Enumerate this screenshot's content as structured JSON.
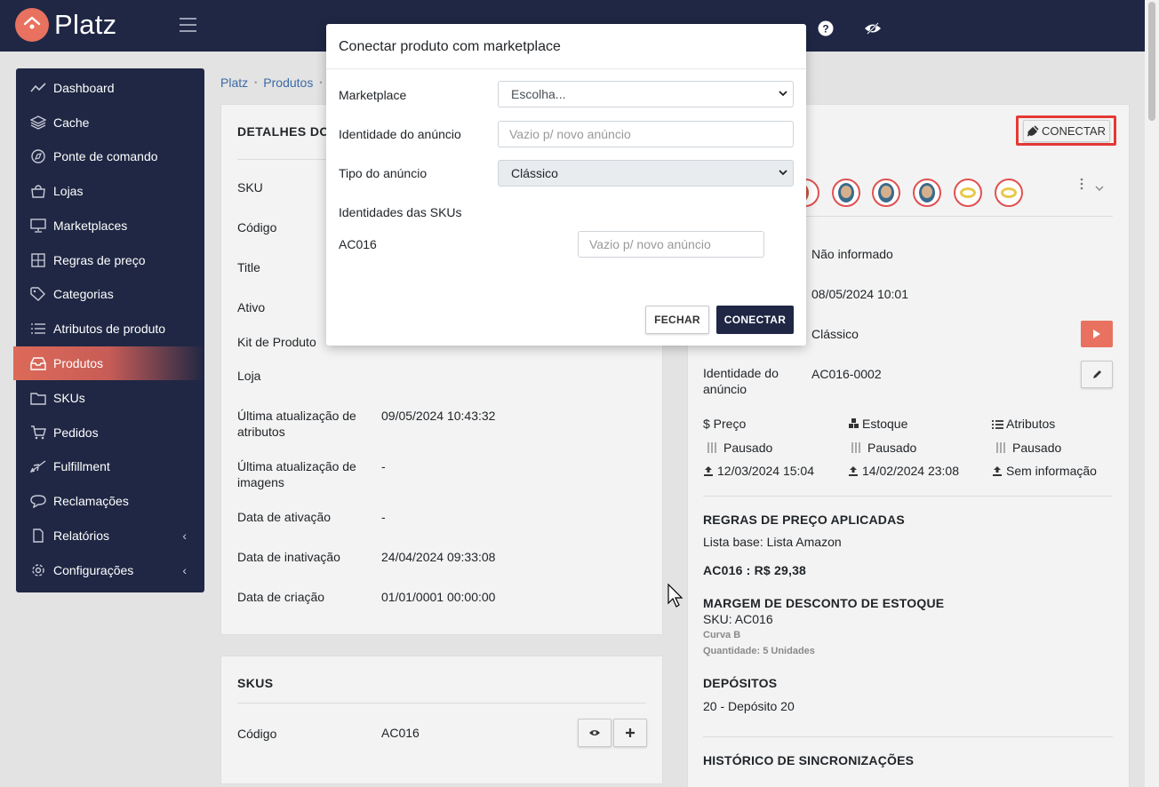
{
  "app": {
    "name": "Platz"
  },
  "colors": {
    "navy": "#1f2744",
    "accent": "#dd6a58",
    "highlight": "#e53935"
  },
  "sidebar": {
    "items": [
      {
        "label": "Dashboard",
        "icon": "chart-line-icon"
      },
      {
        "label": "Cache",
        "icon": "layers-icon"
      },
      {
        "label": "Ponte de comando",
        "icon": "compass-icon"
      },
      {
        "label": "Lojas",
        "icon": "shopping-bag-icon"
      },
      {
        "label": "Marketplaces",
        "icon": "monitor-icon"
      },
      {
        "label": "Regras de preço",
        "icon": "calculator-icon"
      },
      {
        "label": "Categorias",
        "icon": "tag-icon"
      },
      {
        "label": "Atributos de produto",
        "icon": "list-icon"
      },
      {
        "label": "Produtos",
        "icon": "inbox-icon",
        "active": true
      },
      {
        "label": "SKUs",
        "icon": "folder-icon"
      },
      {
        "label": "Pedidos",
        "icon": "cart-icon"
      },
      {
        "label": "Fulfillment",
        "icon": "plane-icon"
      },
      {
        "label": "Reclamações",
        "icon": "chat-bubble-icon"
      },
      {
        "label": "Relatórios",
        "icon": "file-icon",
        "expandable": true
      },
      {
        "label": "Configurações",
        "icon": "gear-icon",
        "expandable": true
      }
    ],
    "chevron": "‹"
  },
  "breadcrumb": {
    "items": [
      "Platz",
      "Produtos"
    ],
    "separator": "•"
  },
  "details": {
    "title": "DETALHES DO",
    "rows": [
      {
        "label": "SKU",
        "value": ""
      },
      {
        "label": "Código",
        "value": ""
      },
      {
        "label": "Title",
        "value": ""
      },
      {
        "label": "Ativo",
        "value": ""
      },
      {
        "label": "Kit de Produto",
        "value": ""
      },
      {
        "label": "Loja",
        "value": ""
      },
      {
        "label": "Última atualização de atributos",
        "value": "09/05/2024 10:43:32"
      },
      {
        "label": "Última atualização de imagens",
        "value": "-"
      },
      {
        "label": "Data de ativação",
        "value": "-"
      },
      {
        "label": "Data de inativação",
        "value": "24/04/2024 09:33:08"
      },
      {
        "label": "Data de criação",
        "value": "01/01/0001 00:00:00"
      }
    ]
  },
  "skus": {
    "title": "SKUS",
    "label": "Código",
    "value": "AC016"
  },
  "marketplace_panel": {
    "connect_label": "CONECTAR",
    "rows": [
      {
        "label": "",
        "value": "Não informado"
      },
      {
        "label": "",
        "value": "08/05/2024 10:01"
      },
      {
        "label": "",
        "value": "Clássico"
      },
      {
        "label": "Identidade do anúncio",
        "value": "AC016-0002"
      }
    ],
    "sync": {
      "headers": [
        "$ Preço",
        "Estoque",
        "Atributos"
      ],
      "status": [
        "Pausado",
        "Pausado",
        "Pausado"
      ],
      "dates": [
        "12/03/2024 15:04",
        "14/02/2024 23:08",
        "Sem informação"
      ]
    },
    "price_rules": {
      "title": "REGRAS DE PREÇO APLICADAS",
      "base": "Lista base: Lista Amazon",
      "price": "AC016 : R$ 29,38"
    },
    "stock_margin": {
      "title": "MARGEM DE DESCONTO DE ESTOQUE",
      "sku": "SKU: AC016",
      "curve": "Curva B",
      "qty": "Quantidade: 5 Unidades"
    },
    "deposits": {
      "title": "DEPÓSITOS",
      "value": "20 - Depósito 20"
    },
    "history": {
      "title": "HISTÓRICO DE SINCRONIZAÇÕES"
    }
  },
  "modal": {
    "title": "Conectar produto com marketplace",
    "marketplace_label": "Marketplace",
    "marketplace_value": "Escolha...",
    "ad_id_label": "Identidade do anúncio",
    "ad_id_placeholder": "Vazio p/ novo anúncio",
    "ad_type_label": "Tipo do anúncio",
    "ad_type_value": "Clássico",
    "sku_ids_label": "Identidades das SKUs",
    "sku_code": "AC016",
    "sku_placeholder": "Vazio p/ novo anúncio",
    "close_label": "FECHAR",
    "connect_label": "CONECTAR"
  }
}
